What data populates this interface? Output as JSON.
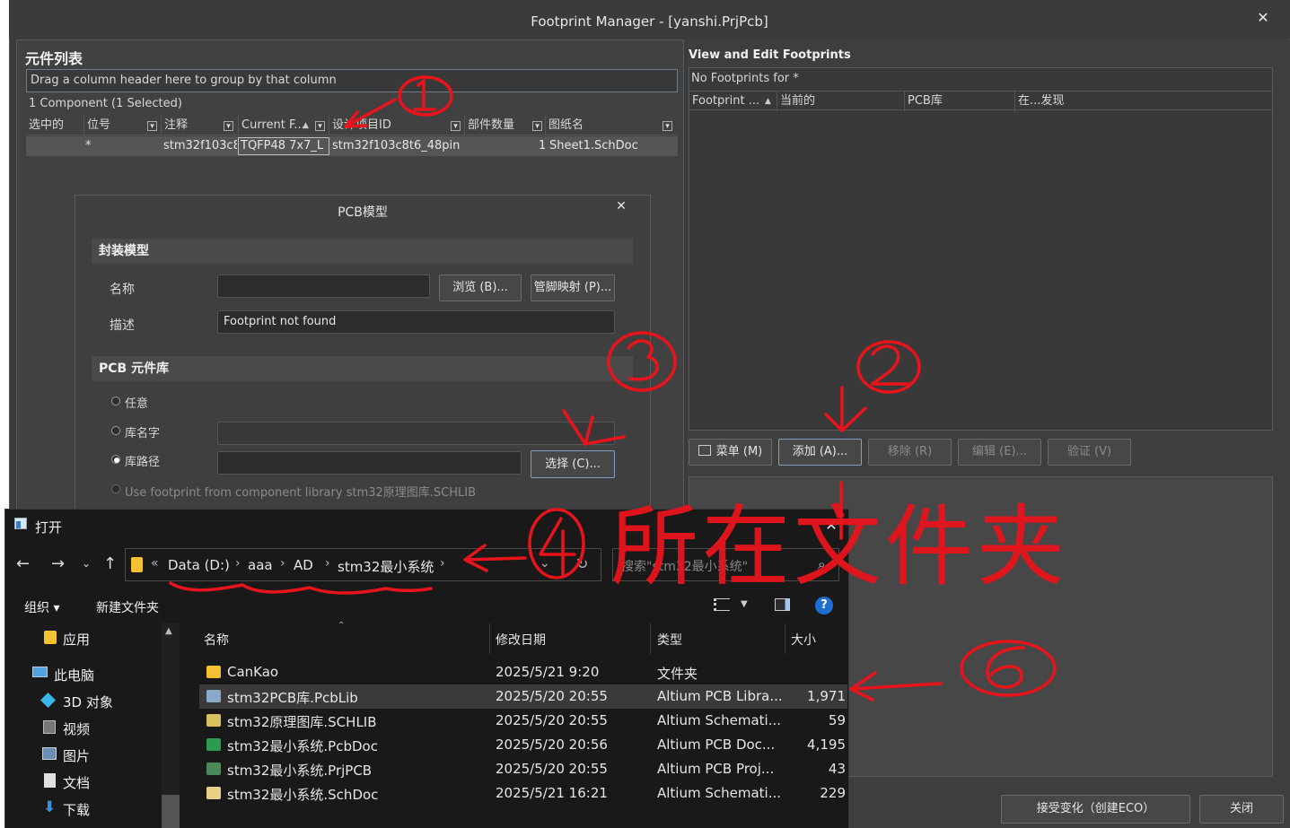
{
  "window": {
    "title": "Footprint Manager - [yanshi.PrjPcb]",
    "close": "✕"
  },
  "left": {
    "section_title": "元件列表",
    "group_hint": "Drag a column header here to group by that column",
    "component_count": "1 Component (1 Selected)",
    "columns": [
      "选中的",
      "位号",
      "注释",
      "Current F...",
      "设计项目ID",
      "部件数量",
      "图纸名"
    ],
    "row": {
      "designator": "*",
      "comment": "stm32f103c8",
      "current_footprint": "TQFP48 7x7_L",
      "design_id": "stm32f103c8t6_48pin",
      "parts": "1",
      "sheet": "Sheet1.SchDoc"
    }
  },
  "pcb_dialog": {
    "title": "PCB模型",
    "close": "✕",
    "footprint_section": "封装模型",
    "name_label": "名称",
    "name_value": "",
    "browse_button": "浏览 (B)...",
    "pinmap_button": "管脚映射 (P)...",
    "desc_label": "描述",
    "desc_value": "Footprint not found",
    "library_section": "PCB 元件库",
    "opt_any": "任意",
    "opt_libname": "库名字",
    "opt_libpath": "库路径",
    "select_button": "选择 (C)...",
    "opt_component_lib": "Use footprint from component library stm32原理图库.SCHLIB"
  },
  "right": {
    "section_title": "View and Edit Footprints",
    "no_footprints": "No Footprints for *",
    "columns": [
      "Footprint ...",
      "当前的",
      "PCB库",
      "在...发现"
    ],
    "buttons": {
      "menu": "菜单 (M)",
      "add": "添加 (A)...",
      "remove": "移除 (R)",
      "edit": "编辑 (E)...",
      "validate": "验证 (V)"
    },
    "accept_button": "接受变化（创建ECO）",
    "close_button": "关闭"
  },
  "open_dialog": {
    "title": "打开",
    "close": "✕",
    "path": [
      "Data (D:)",
      "aaa",
      "AD",
      "stm32最小系统"
    ],
    "search_placeholder": "搜索\"stm32最小系统\"",
    "organize": "组织 ▾",
    "new_folder": "新建文件夹",
    "tree": [
      "应用",
      "此电脑",
      "3D 对象",
      "视频",
      "图片",
      "文档",
      "下载"
    ],
    "headers": {
      "name": "名称",
      "date": "修改日期",
      "type": "类型",
      "size": "大小"
    },
    "files": [
      {
        "name": "CanKao",
        "date": "2025/5/21 9:20",
        "type": "文件夹",
        "size": "",
        "icon": "folder-icon",
        "selected": false
      },
      {
        "name": "stm32PCB库.PcbLib",
        "date": "2025/5/20 20:55",
        "type": "Altium PCB Libra...",
        "size": "1,971",
        "icon": "pcblib-icon",
        "selected": true
      },
      {
        "name": "stm32原理图库.SCHLIB",
        "date": "2025/5/20 20:55",
        "type": "Altium Schemati...",
        "size": "59",
        "icon": "schlib-icon",
        "selected": false
      },
      {
        "name": "stm32最小系统.PcbDoc",
        "date": "2025/5/20 20:56",
        "type": "Altium PCB Doc...",
        "size": "4,195",
        "icon": "pcbdoc-icon",
        "selected": false
      },
      {
        "name": "stm32最小系统.PrjPCB",
        "date": "2025/5/20 20:55",
        "type": "Altium PCB Proj...",
        "size": "43",
        "icon": "prjpcb-icon",
        "selected": false
      },
      {
        "name": "stm32最小系统.SchDoc",
        "date": "2025/5/21 16:21",
        "type": "Altium Schemati...",
        "size": "229",
        "icon": "schdoc-icon",
        "selected": false
      }
    ]
  },
  "annotations": {
    "text_folder": "所在文件夹",
    "color": "#e8141c"
  }
}
